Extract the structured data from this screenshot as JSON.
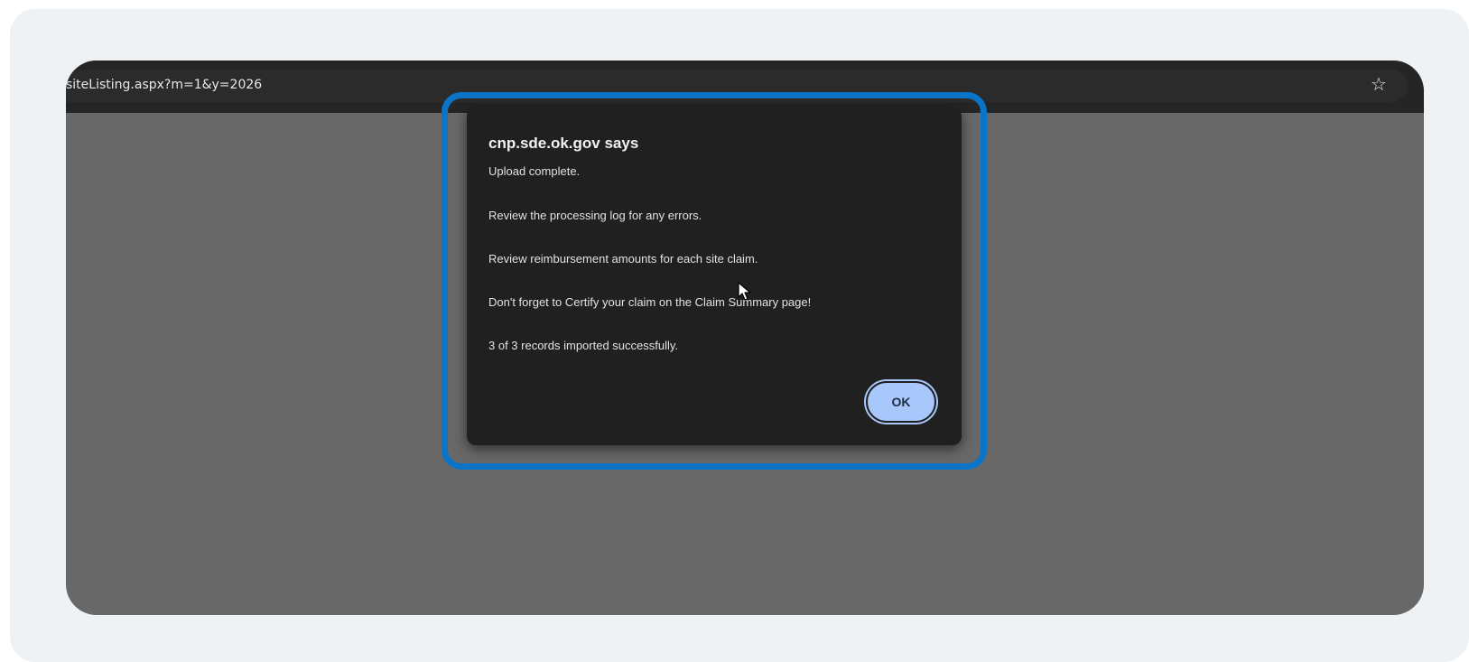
{
  "browser": {
    "url": "siteListing.aspx?m=1&y=2026",
    "bookmark_icon": "star-icon"
  },
  "dialog": {
    "title": "cnp.sde.ok.gov says",
    "lines": [
      "Upload complete.",
      "Review the processing log for any errors.",
      "Review reimbursement amounts for each site claim.",
      "Don't forget to Certify your claim on the Claim Summary page!",
      "3 of 3 records imported successfully."
    ],
    "ok_label": "OK"
  },
  "colors": {
    "highlight": "#0b74c7",
    "ok_button": "#a8c7fa",
    "dialog_bg": "#202020",
    "page_dim": "#686868"
  }
}
